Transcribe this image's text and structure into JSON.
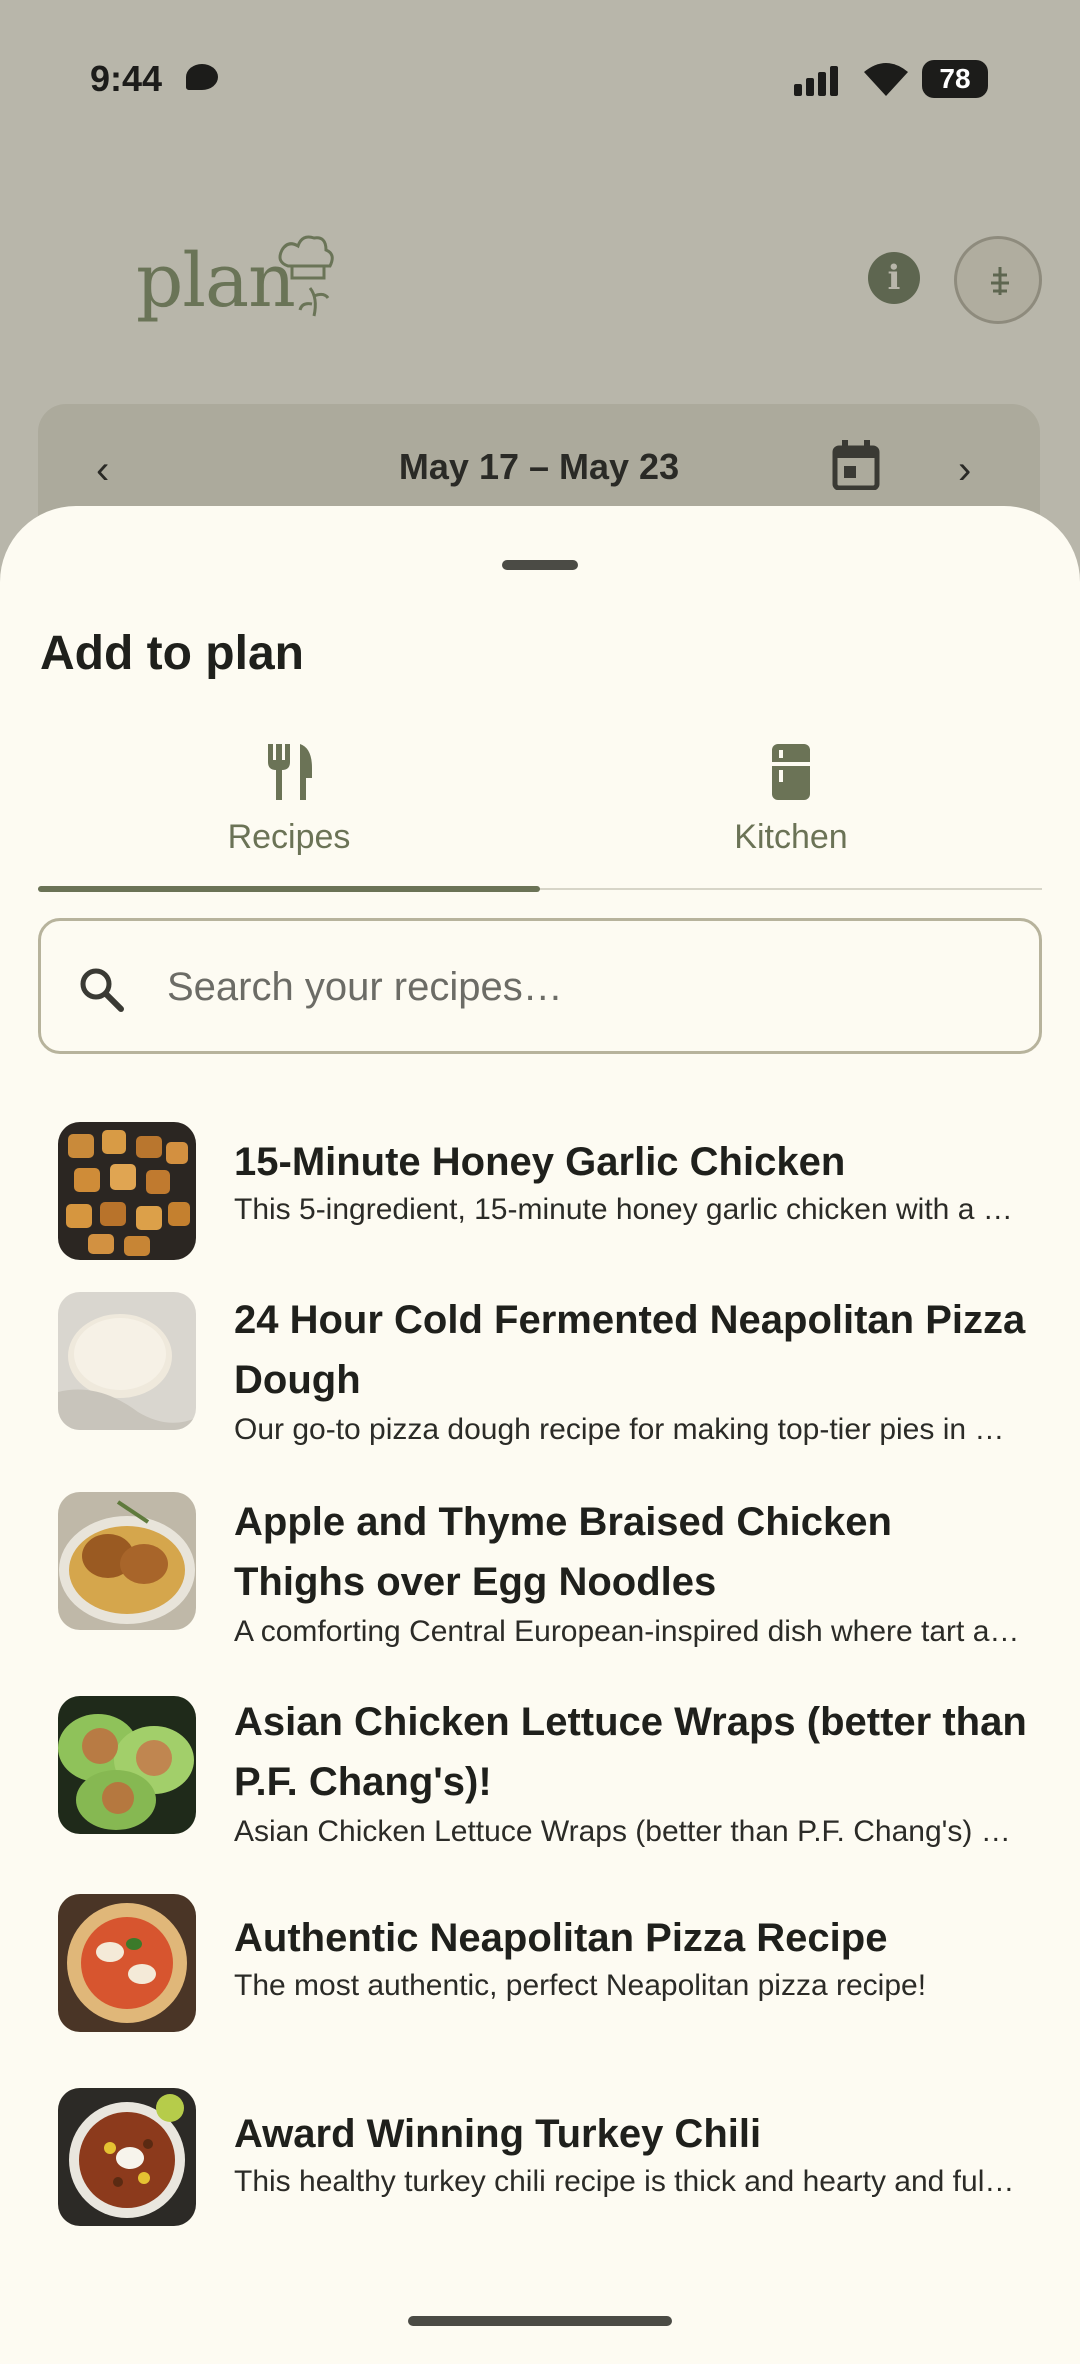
{
  "status_bar": {
    "time": "9:44",
    "battery": "78"
  },
  "header": {
    "logo_text": "plan",
    "info_icon": "info-icon",
    "profile_icon": "profile-icon"
  },
  "week_nav": {
    "range": "May 17 – May 23",
    "prev_icon": "chevron-left-icon",
    "next_icon": "chevron-right-icon",
    "calendar_icon": "calendar-icon"
  },
  "sheet": {
    "title": "Add to plan",
    "tabs": [
      {
        "label": "Recipes",
        "icon": "fork-knife-icon",
        "selected": true
      },
      {
        "label": "Kitchen",
        "icon": "fridge-icon",
        "selected": false
      }
    ],
    "search": {
      "placeholder": "Search your recipes…",
      "value": ""
    },
    "recipes": [
      {
        "title": "15-Minute Honey Garlic Chicken",
        "description": "This 5-ingredient, 15-minute honey garlic chicken with a sticky glaze",
        "image": "honey-garlic-chicken-photo"
      },
      {
        "title": "24 Hour Cold Fermented Neapolitan Pizza Dough",
        "description": "Our go-to pizza dough recipe for making top-tier pies in a home oven",
        "image": "pizza-dough-photo"
      },
      {
        "title": "Apple and Thyme Braised Chicken Thighs over Egg Noodles",
        "description": "A comforting Central European-inspired dish where tart apples and thyme",
        "image": "braised-chicken-photo"
      },
      {
        "title": "Asian Chicken Lettuce Wraps (better than P.F. Chang's)!",
        "description": "Asian Chicken Lettuce Wraps (better than P.F. Chang's) are quick and easy",
        "image": "lettuce-wraps-photo"
      },
      {
        "title": "Authentic Neapolitan Pizza Recipe",
        "description": "The most authentic, perfect Neapolitan pizza recipe!",
        "image": "neapolitan-pizza-photo"
      },
      {
        "title": "Award Winning Turkey Chili",
        "description": "This healthy turkey chili recipe is thick and hearty and full of flavor",
        "image": "turkey-chili-photo"
      }
    ]
  },
  "colors": {
    "accent": "#6b7356",
    "sheet_bg": "#fdfbf2",
    "scrim": "#b8b6aa"
  }
}
